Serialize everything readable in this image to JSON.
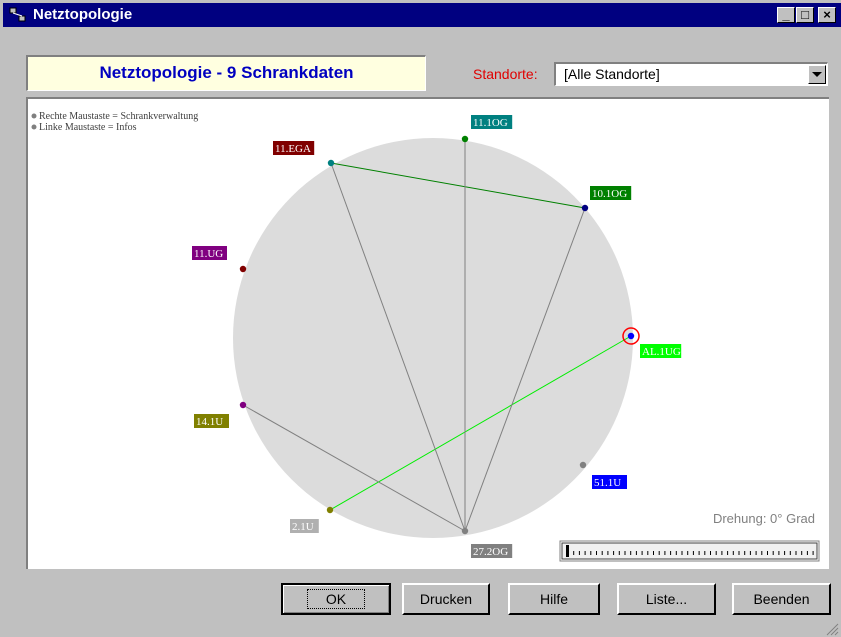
{
  "window": {
    "title": "Netztopologie"
  },
  "header": {
    "title": "Netztopologie - 9 Schrankdaten"
  },
  "standorte": {
    "label": "Standorte:",
    "value": "[Alle Standorte]"
  },
  "hints": [
    "Rechte Maustaste = Schrankverwaltung",
    "Linke Maustaste = Infos"
  ],
  "rotation": {
    "label": "Drehung: 0° Grad",
    "value": 0
  },
  "nodes": [
    {
      "id": "11.1OG",
      "color": "#008080",
      "dot": "#008000"
    },
    {
      "id": "10.1OG",
      "color": "#008000",
      "dot": "#000080"
    },
    {
      "id": "AL.1UG",
      "color": "#00ff00",
      "dot": "#0000ff"
    },
    {
      "id": "51.1U",
      "color": "#0000ff",
      "dot": "#808080"
    },
    {
      "id": "27.2OG",
      "color": "#808080",
      "dot": "#808080"
    },
    {
      "id": "2.1U",
      "color": "#b0b0b0",
      "dot": "#808000"
    },
    {
      "id": "14.1U",
      "color": "#808000",
      "dot": "#800080"
    },
    {
      "id": "11.UG",
      "color": "#800080",
      "dot": "#800000"
    },
    {
      "id": "11.EGA",
      "color": "#800000",
      "dot": "#008080"
    }
  ],
  "connections": [
    {
      "from": "11.EGA",
      "to": "10.1OG",
      "color": "#008000"
    },
    {
      "from": "2.1U",
      "to": "AL.1UG",
      "color": "#00ee00"
    },
    {
      "from": "11.EGA",
      "to": "27.2OG",
      "color": "#808080"
    },
    {
      "from": "11.1OG",
      "to": "27.2OG",
      "color": "#808080"
    },
    {
      "from": "10.1OG",
      "to": "27.2OG",
      "color": "#808080"
    },
    {
      "from": "14.1U",
      "to": "27.2OG",
      "color": "#808080"
    }
  ],
  "selected_node": "AL.1UG",
  "buttons": {
    "ok": "OK",
    "print": "Drucken",
    "help": "Hilfe",
    "list": "Liste...",
    "exit": "Beenden"
  }
}
